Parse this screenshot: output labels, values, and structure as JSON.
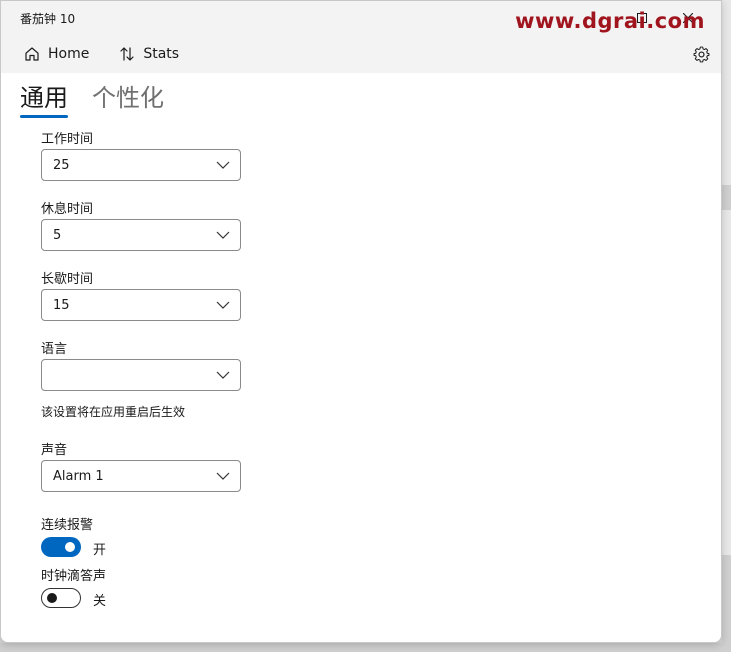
{
  "window": {
    "title": "番茄钟 10",
    "watermark": "www.dgrai.com"
  },
  "navbar": {
    "home_label": "Home",
    "stats_label": "Stats"
  },
  "pivot": {
    "tabs": [
      {
        "label": "通用",
        "selected": true
      },
      {
        "label": "个性化",
        "selected": false
      }
    ]
  },
  "settings": {
    "work_time": {
      "label": "工作时间",
      "value": "25"
    },
    "break_time": {
      "label": "休息时间",
      "value": "5"
    },
    "long_break": {
      "label": "长歇时间",
      "value": "15"
    },
    "language": {
      "label": "语言",
      "value": "",
      "note": "该设置将在应用重启后生效"
    },
    "sound": {
      "label": "声音",
      "value": "Alarm 1"
    },
    "continuous_alarm": {
      "label": "连续报警",
      "state": "开",
      "on": true
    },
    "tick_sound": {
      "label": "时钟滴答声",
      "state": "关",
      "on": false
    }
  },
  "colors": {
    "accent": "#0067c0",
    "watermark": "#a0141e"
  },
  "icons": {
    "home": "home-icon",
    "stats": "sort-arrows-icon",
    "settings": "gear-icon",
    "chevron": "chevron-down-icon"
  }
}
